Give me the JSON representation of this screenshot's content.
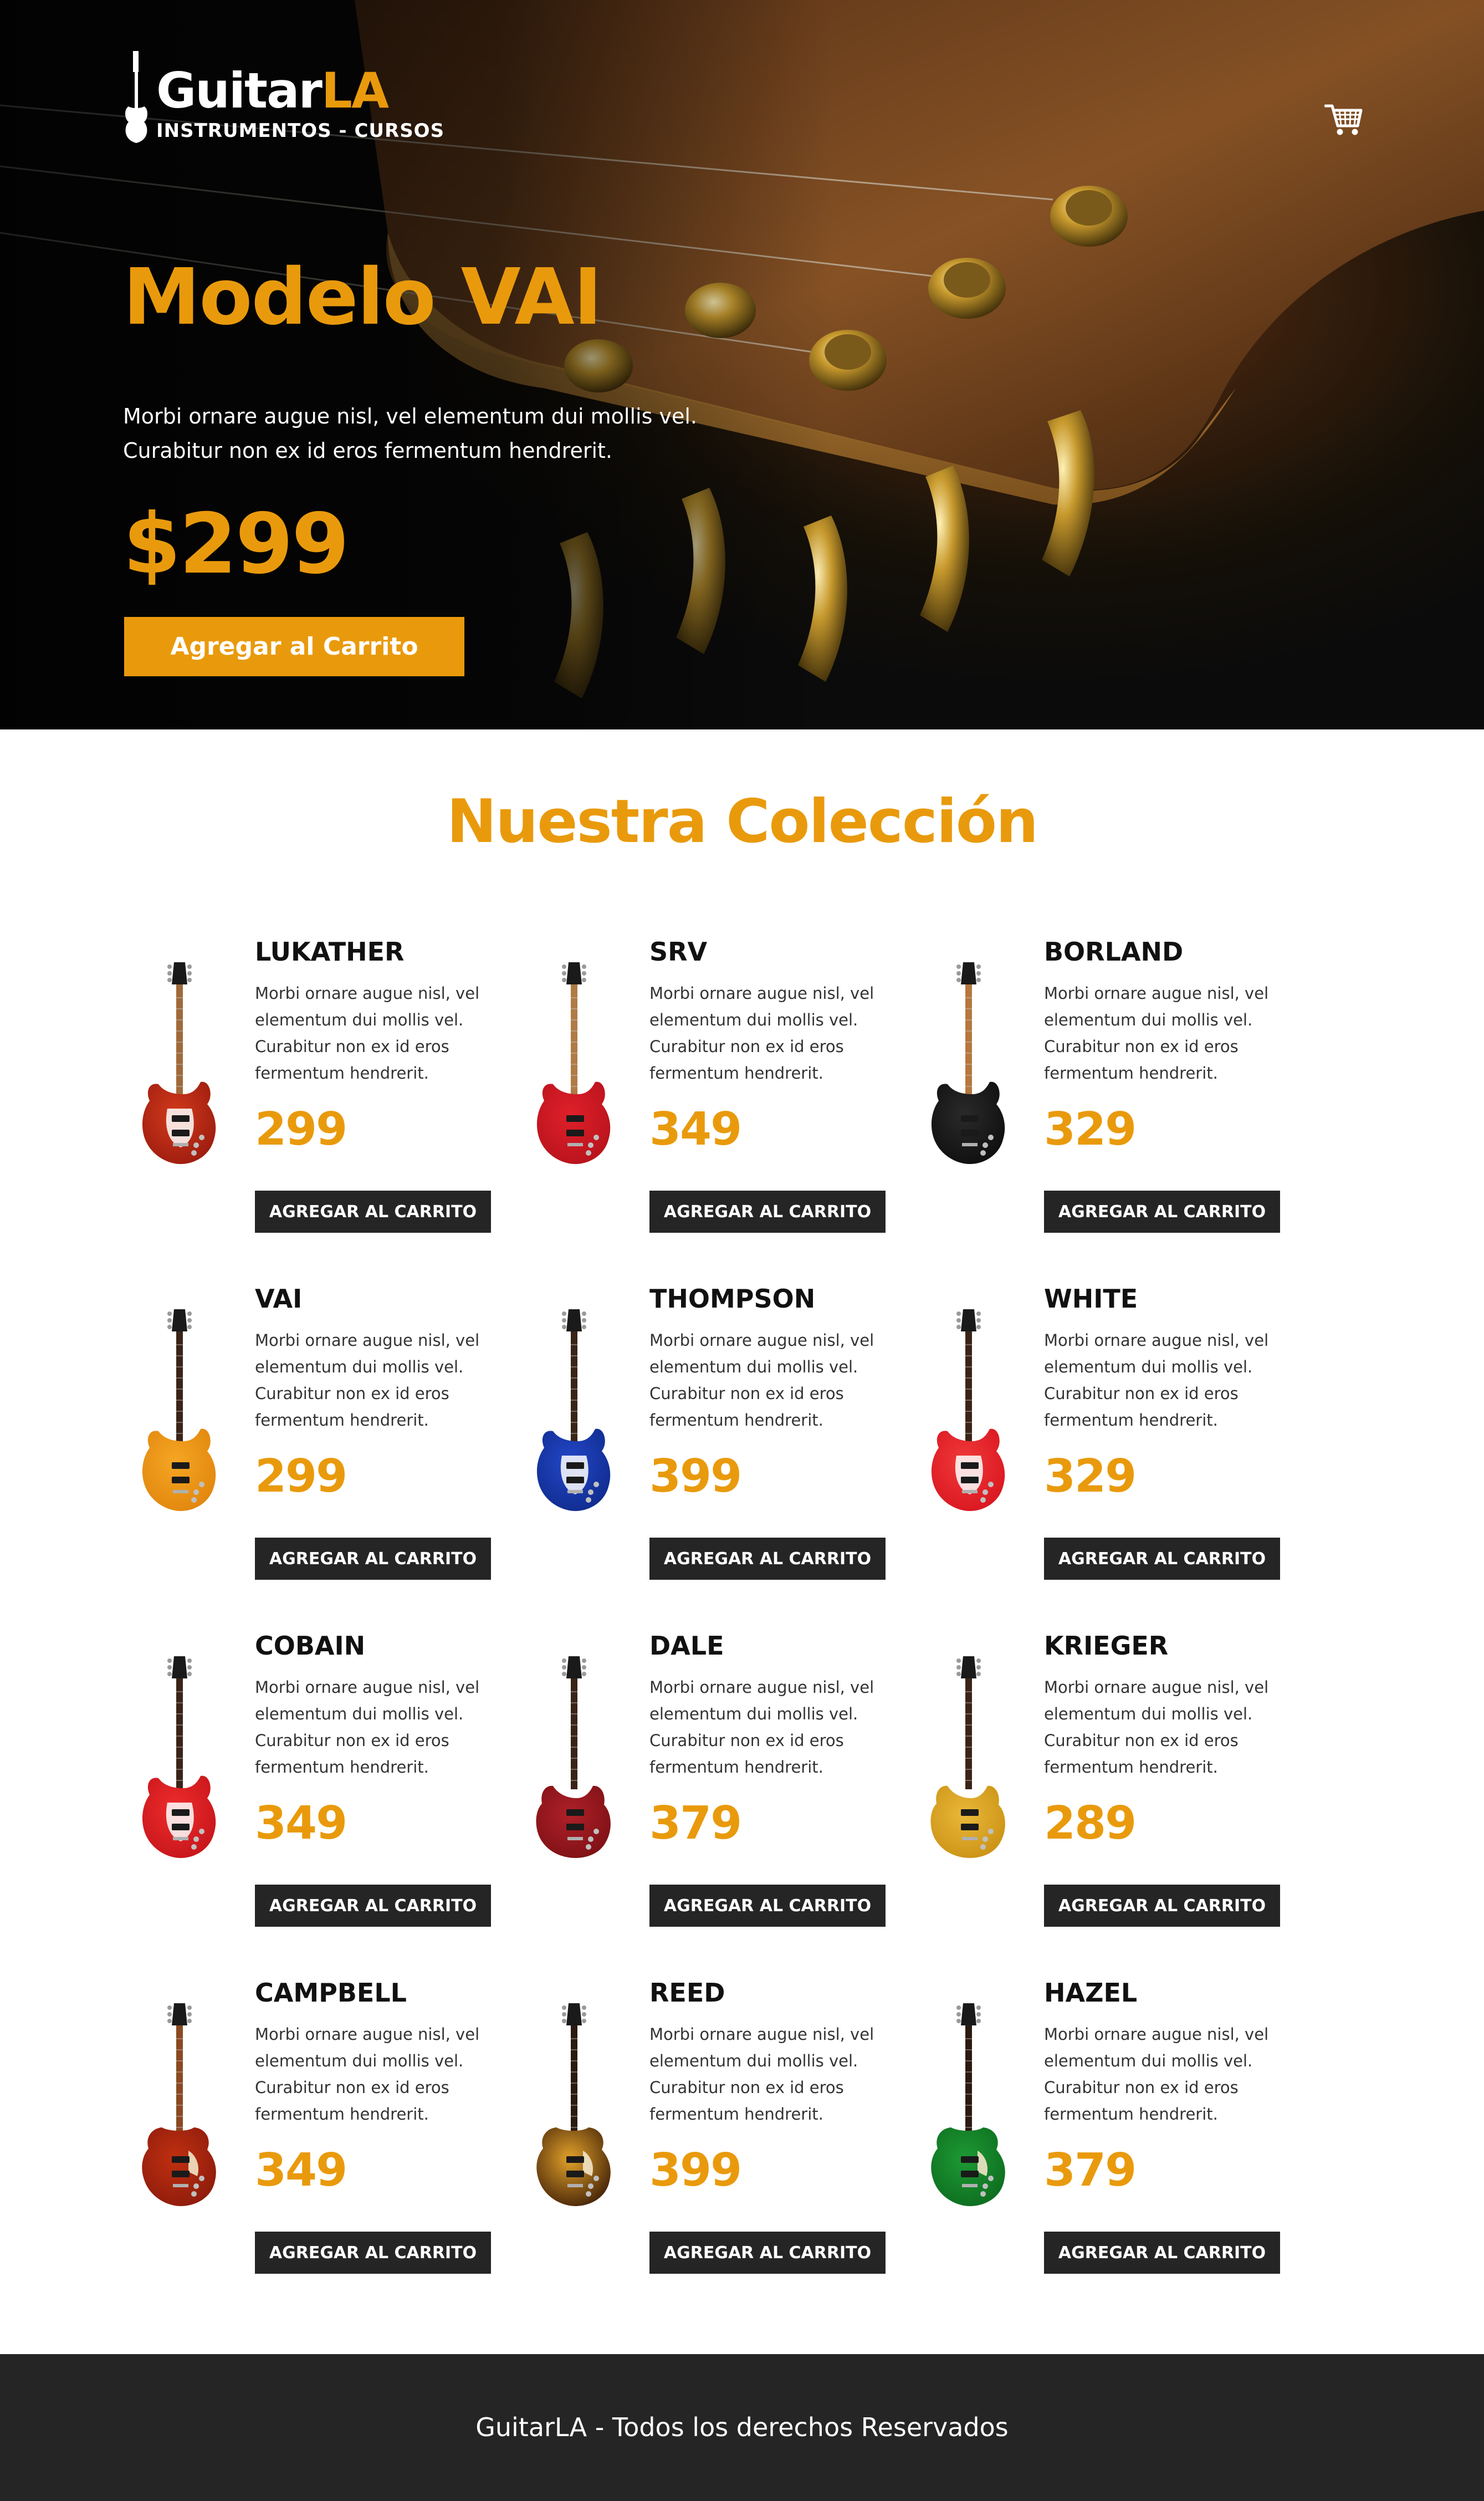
{
  "brand": {
    "name_part1": "Guitar",
    "name_part2": "LA",
    "tagline": "INSTRUMENTOS - CURSOS",
    "accent_color": "#e99a0c",
    "dark_color": "#252525"
  },
  "header": {
    "cart_icon": "cart-icon"
  },
  "hero": {
    "title": "Modelo VAI",
    "description_line1": "Morbi ornare augue nisl, vel elementum dui mollis vel.",
    "description_line2": "Curabitur non ex id eros fermentum hendrerit.",
    "price": "$299",
    "button_label": "Agregar al Carrito"
  },
  "collection": {
    "title": "Nuestra Colección",
    "desc_line1": "Morbi ornare augue nisl, vel",
    "desc_line2": "elementum dui mollis vel.",
    "desc_line3": "Curabitur non ex id eros",
    "desc_line4": "fermentum hendrerit.",
    "button_label": "AGREGAR AL CARRITO",
    "items": [
      {
        "name": "LUKATHER",
        "price": "299",
        "body": "#9a1a0e",
        "body2": "#d13a1c",
        "neck": "#a06a3a",
        "style": "strat"
      },
      {
        "name": "SRV",
        "price": "349",
        "body": "#b5121b",
        "body2": "#e0202a",
        "neck": "#b07a45",
        "style": "superstrat"
      },
      {
        "name": "BORLAND",
        "price": "329",
        "body": "#0d0d0d",
        "body2": "#2a2a2a",
        "neck": "#b5783e",
        "style": "superstrat"
      },
      {
        "name": "VAI",
        "price": "299",
        "body": "#e0840c",
        "body2": "#f5a623",
        "neck": "#3a2418",
        "style": "superstrat"
      },
      {
        "name": "THOMPSON",
        "price": "399",
        "body": "#0f2a8a",
        "body2": "#2347c8",
        "neck": "#3a2418",
        "style": "strat"
      },
      {
        "name": "WHITE",
        "price": "329",
        "body": "#d8141e",
        "body2": "#f03a3a",
        "neck": "#3a2418",
        "style": "strat"
      },
      {
        "name": "COBAIN",
        "price": "349",
        "body": "#c4141a",
        "body2": "#ee2c2c",
        "neck": "#3a2418",
        "style": "strat"
      },
      {
        "name": "DALE",
        "price": "379",
        "body": "#7a1014",
        "body2": "#b02028",
        "neck": "#3a2418",
        "style": "sg"
      },
      {
        "name": "KRIEGER",
        "price": "289",
        "body": "#c99012",
        "body2": "#eab83a",
        "neck": "#3a2418",
        "style": "sg"
      },
      {
        "name": "CAMPBELL",
        "price": "349",
        "body": "#8a1a0c",
        "body2": "#c03010",
        "neck": "#8a4a22",
        "style": "lespaul"
      },
      {
        "name": "REED",
        "price": "399",
        "body": "#3a1a06",
        "body2": "#e2a22a",
        "neck": "#2a1a10",
        "style": "lespaul"
      },
      {
        "name": "HAZEL",
        "price": "379",
        "body": "#0c6a1e",
        "body2": "#1e9a34",
        "neck": "#2a1a10",
        "style": "lespaul"
      }
    ]
  },
  "footer": {
    "text": "GuitarLA - Todos los derechos Reservados"
  }
}
